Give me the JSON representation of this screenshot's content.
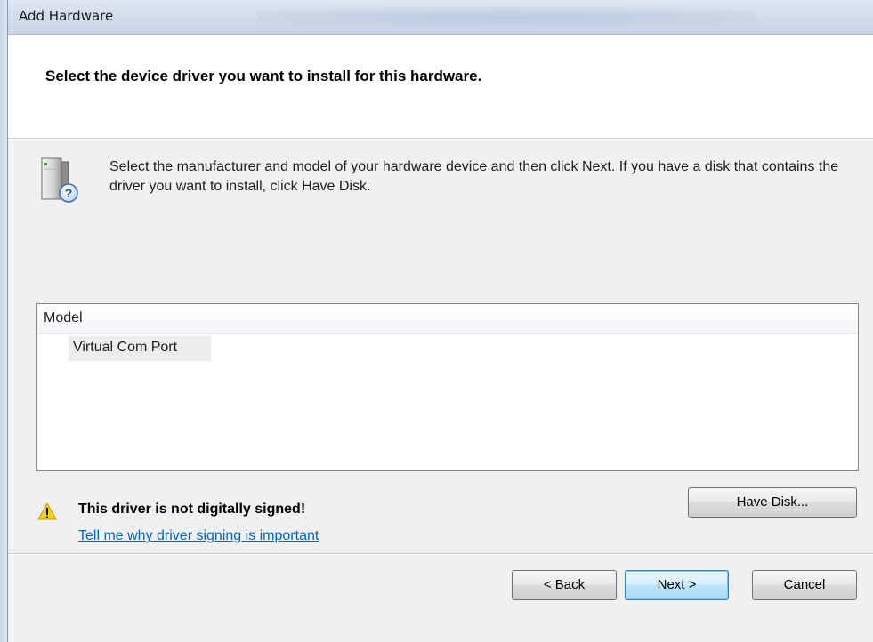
{
  "window": {
    "title": "Add Hardware"
  },
  "header": {
    "heading": "Select the device driver you want to install for this hardware."
  },
  "instructions": {
    "text": "Select the manufacturer and model of your hardware device and then click Next. If you have a disk that contains the driver you want to install, click Have Disk.",
    "icon": "hardware-help-icon"
  },
  "model_list": {
    "column_header": "Model",
    "items": [
      {
        "label": "Virtual Com Port",
        "selected": true
      }
    ]
  },
  "warning": {
    "icon": "warning-icon",
    "text": "This driver is not digitally signed!",
    "link": "Tell me why driver signing is important"
  },
  "buttons": {
    "have_disk": "Have Disk...",
    "back": "< Back",
    "next": "Next >",
    "cancel": "Cancel"
  },
  "colors": {
    "link": "#0066cc",
    "default_button_border": "#3c7fb1",
    "dialog_background": "#f0f0f0"
  }
}
